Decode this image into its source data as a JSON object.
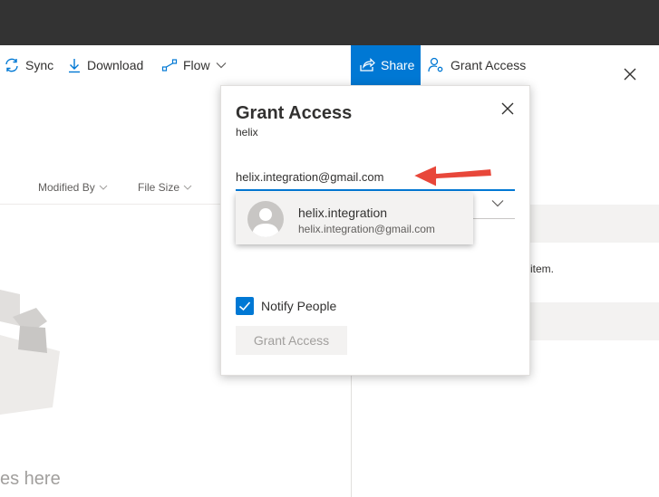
{
  "toolbar": {
    "sync_label": "Sync",
    "download_label": "Download",
    "flow_label": "Flow"
  },
  "list": {
    "columns": [
      "Modified By",
      "File Size"
    ],
    "empty_text": "es here"
  },
  "panel": {
    "share_label": "Share",
    "grant_access_label": "Grant Access",
    "info_text": "item."
  },
  "dialog": {
    "title": "Grant Access",
    "subtitle": "helix",
    "email_value": "helix.integration@gmail.com",
    "suggestion": {
      "name": "helix.integration",
      "email": "helix.integration@gmail.com"
    },
    "notify_label": "Notify People",
    "notify_checked": true,
    "grant_button_label": "Grant Access"
  },
  "colors": {
    "accent": "#0078d4",
    "topbar": "#333333",
    "annotation_arrow": "#e8473a"
  }
}
